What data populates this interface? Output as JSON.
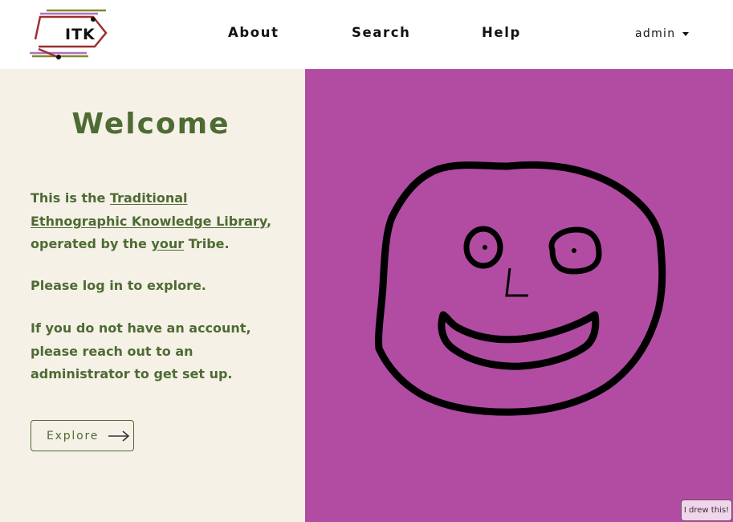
{
  "header": {
    "logo_text": "ITK",
    "nav": {
      "about": "About",
      "search": "Search",
      "help": "Help"
    },
    "user_menu_label": "admin"
  },
  "main": {
    "welcome_title": "Welcome",
    "intro": {
      "prefix": "This is the ",
      "library_link": "Traditional Ethnographic Knowledge Library",
      "middle": ", operated by the ",
      "tribe_link": "your",
      "suffix": " Tribe."
    },
    "login_prompt": "Please log in to explore.",
    "account_note": "If you do not have an account, please reach out to an administrator to get set up.",
    "explore_button": "Explore"
  },
  "art_credit_button": "I drew this!",
  "colors": {
    "panel_bg": "#f6f1e7",
    "accent_green": "#4d6b33",
    "art_bg": "#b24ca2",
    "logo_line_red": "#9b2f2f",
    "logo_line_purple": "#b36fbf",
    "logo_line_olive": "#7f8a2f"
  },
  "icons": {
    "explore_arrow": "long-arrow-right-icon",
    "user_menu_caret": "caret-down-icon",
    "artwork": "smiley-face-drawing"
  }
}
